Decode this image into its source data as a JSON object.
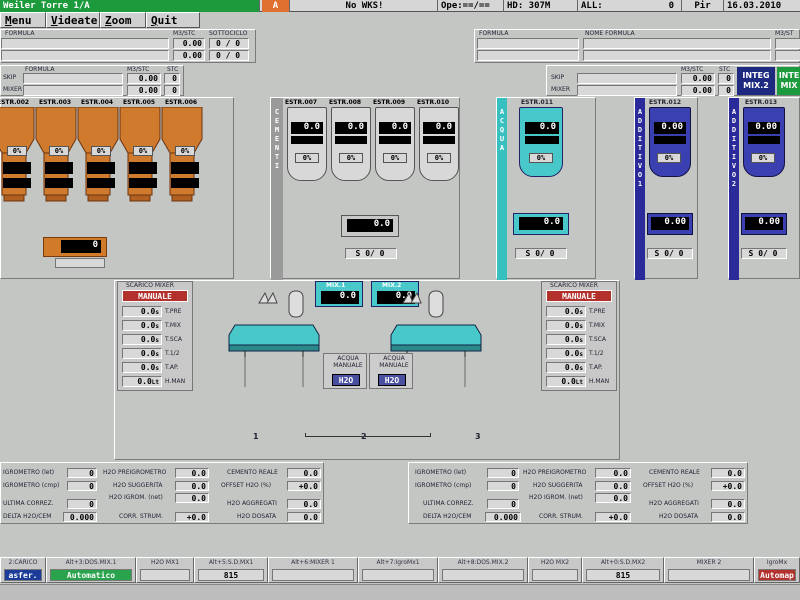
{
  "status_bar": {
    "title": "Weiler Torre 1/A",
    "alarm": "A",
    "wks": "No WKS!",
    "ope": "Ope:==/==",
    "hd": "HD: 307M",
    "all_label": "ALL:",
    "all_value": "0",
    "pir": "Pir",
    "date": "16.03.2010"
  },
  "menu": [
    {
      "key": "M",
      "rest": "enu"
    },
    {
      "key": "V",
      "rest": "ideate"
    },
    {
      "key": "Z",
      "rest": "oom"
    },
    {
      "key": "Q",
      "rest": "uit"
    }
  ],
  "formula_left": {
    "formula_label": "FORMULA",
    "m3_label": "M3/STC",
    "sott_label": "SOTTOCICLO",
    "rows": [
      {
        "value": "0.00",
        "frac_a": "0",
        "frac_b": "0"
      },
      {
        "value": "0.00",
        "frac_a": "0",
        "frac_b": "0"
      }
    ]
  },
  "formula_left2": {
    "formula_label": "FORMULA",
    "m3_label": "M3/STC",
    "stc_label": "STC",
    "skip_label": "SKIP",
    "mixer_label": "MIXER",
    "skip_value": "0.00",
    "skip_stc": "0",
    "mixer_value": "0.00",
    "mixer_stc": "0"
  },
  "formula_right": {
    "formula_label": "FORMULA",
    "nome_label": "NOME FORMULA",
    "m3_label": "M3/ST"
  },
  "formula_right2": {
    "m3_label": "M3/STC",
    "stc_label": "STC",
    "skip_label": "SKIP",
    "mixer_label": "MIXER",
    "skip_value": "0.00",
    "skip_stc": "0",
    "mixer_value": "0.00",
    "mixer_stc": "0",
    "integ_label": "INTEG MIX.2",
    "integ2_label": "INTE MIX"
  },
  "aggregates": {
    "hoppers": [
      {
        "label": "ESTR.002",
        "pct": "0%"
      },
      {
        "label": "ESTR.003",
        "pct": "0%"
      },
      {
        "label": "ESTR.004",
        "pct": "0%"
      },
      {
        "label": "ESTR.005",
        "pct": "0%"
      },
      {
        "label": "ESTR.006",
        "pct": "0%"
      }
    ],
    "scale_value": "0"
  },
  "cement": {
    "vlabel": [
      "C",
      "E",
      "M",
      "E",
      "N",
      "T",
      "I"
    ],
    "silos": [
      {
        "label": "ESTR.007",
        "value": "0.0",
        "pct": "0%"
      },
      {
        "label": "ESTR.008",
        "value": "0.0",
        "pct": "0%"
      },
      {
        "label": "ESTR.009",
        "value": "0.0",
        "pct": "0%"
      },
      {
        "label": "ESTR.010",
        "value": "0.0",
        "pct": "0%"
      }
    ],
    "scale_value": "0.0",
    "scale_s": "S",
    "scale_frac": "0/ 0"
  },
  "water": {
    "vlabel": [
      "A",
      "C",
      "Q",
      "U",
      "A"
    ],
    "silo": {
      "label": "ESTR.011",
      "value": "0.0",
      "pct": "0%"
    },
    "scale_value": "0.0",
    "scale_s": "S",
    "scale_frac": "0/ 0"
  },
  "additive1": {
    "vlabel": [
      "A",
      "D",
      "D",
      "I",
      "T",
      "I",
      "V",
      "O",
      "1"
    ],
    "silo": {
      "label": "ESTR.012",
      "value": "0.00",
      "pct": "0%"
    },
    "scale_value": "0.00",
    "scale_s": "S",
    "scale_frac": "0/ 0"
  },
  "additive2": {
    "vlabel": [
      "A",
      "D",
      "D",
      "I",
      "T",
      "I",
      "V",
      "O",
      "2"
    ],
    "silo": {
      "label": "ESTR.013",
      "value": "0.00",
      "pct": "0%"
    },
    "scale_value": "0.00",
    "scale_s": "S",
    "scale_frac": "0/ 0"
  },
  "mixer_left": {
    "title": "SCARICO MIXER",
    "mode": "MANUALE",
    "rows": [
      {
        "value": "0.0",
        "unit": "s",
        "label": "T.PRE"
      },
      {
        "value": "0.0",
        "unit": "s",
        "label": "T.MIX"
      },
      {
        "value": "0.0",
        "unit": "s",
        "label": "T.SCA"
      },
      {
        "value": "0.0",
        "unit": "s",
        "label": "T.1/2"
      },
      {
        "value": "0.0",
        "unit": "s",
        "label": "T.AP."
      },
      {
        "value": "0.0",
        "unit": "Lt",
        "label": "H.MAN"
      }
    ]
  },
  "mixer_right": {
    "title": "SCARICO MIXER",
    "mode": "MANUALE",
    "rows": [
      {
        "value": "0.0",
        "unit": "s",
        "label": "T.PRE"
      },
      {
        "value": "0.0",
        "unit": "s",
        "label": "T.MIX"
      },
      {
        "value": "0.0",
        "unit": "s",
        "label": "T.SCA"
      },
      {
        "value": "0.0",
        "unit": "s",
        "label": "T.1/2"
      },
      {
        "value": "0.0",
        "unit": "s",
        "label": "T.AP."
      },
      {
        "value": "0.0",
        "unit": "Lt",
        "label": "H.MAN"
      }
    ]
  },
  "mixers": {
    "m1_title": "MIX.1",
    "m1_value": "0.0",
    "m2_title": "MIX.2",
    "m2_value": "0.0",
    "water_btn1_label": "ACQUA MANUALE",
    "water_btn1": "H2O",
    "water_btn2_label": "ACQUA MANUALE",
    "water_btn2": "H2O",
    "num1": "1",
    "num2": "2",
    "num3": "3"
  },
  "h2o_left": {
    "igro_let": "IGROMETRO (let)",
    "igro_let_v": "0",
    "igro_cmp": "IGROMETRO (cmp)",
    "igro_cmp_v": "0",
    "ult_corr": "ULTIMA CORREZ.",
    "ult_corr_v": "0",
    "delta": "DELTA H2O/CEM",
    "delta_v": "0.000",
    "pre": "H2O PREIGROMETRO",
    "pre_v": "0.0",
    "sugg": "H2O SUGGERITA",
    "sugg_v": "0.0",
    "igrom_net": "H2O IGROM. (net)",
    "igrom_net_v": "0.0",
    "corr_strum": "CORR. STRUM.",
    "corr_strum_v": "+0.0",
    "cem_reale": "CEMENTO REALE",
    "cem_reale_v": "0.0",
    "offset": "OFFSET H2O (%)",
    "offset_v": "+0.0",
    "aggr": "H2O AGGREGATI",
    "aggr_v": "0.0",
    "dosata": "H2O DOSATA",
    "dosata_v": "0.0"
  },
  "h2o_right": {
    "igro_let": "IGROMETRO (let)",
    "igro_let_v": "0",
    "igro_cmp": "IGROMETRO (cmp)",
    "igro_cmp_v": "0",
    "ult_corr": "ULTIMA CORREZ.",
    "ult_corr_v": "0",
    "delta": "DELTA H2O/CEM",
    "delta_v": "0.000",
    "pre": "H2O PREIGROMETRO",
    "pre_v": "0.0",
    "sugg": "H2O SUGGERITA",
    "sugg_v": "0.0",
    "igrom_net": "H2O IGROM. (net)",
    "igrom_net_v": "0.0",
    "corr_strum": "CORR. STRUM.",
    "corr_strum_v": "+0.0",
    "cem_reale": "CEMENTO REALE",
    "cem_reale_v": "0.0",
    "offset": "OFFSET H2O (%)",
    "offset_v": "+0.0",
    "aggr": "H2O AGGREGATI",
    "aggr_v": "0.0",
    "dosata": "H2O DOSATA",
    "dosata_v": "0.0"
  },
  "function_keys": [
    {
      "title": "2:CARICO",
      "value": "asfer."
    },
    {
      "title": "Alt+3:DOS.MIX.1",
      "value": "Automatico"
    },
    {
      "title": "H2O MX1",
      "value": ""
    },
    {
      "title": "Alt+5:S.D.MX1",
      "value": "815"
    },
    {
      "title": "Alt+6:MIXER 1",
      "value": ""
    },
    {
      "title": "Alt+7:IgroMx1",
      "value": ""
    },
    {
      "title": "Alt+8:DOS.MIX.2",
      "value": ""
    },
    {
      "title": "H2O MX2",
      "value": ""
    },
    {
      "title": "Alt+0:S.D.MX2",
      "value": "815"
    },
    {
      "title": "MIXER 2",
      "value": ""
    },
    {
      "title": "IgroMx",
      "value": "Automap"
    }
  ]
}
